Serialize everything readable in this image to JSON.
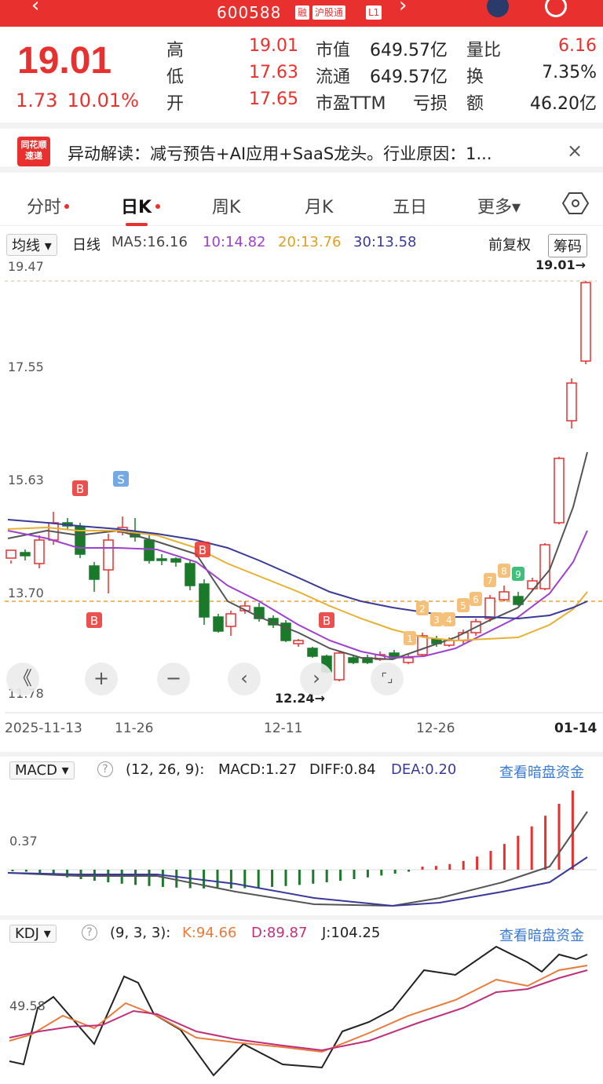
{
  "header": {
    "code": "600588",
    "badges": [
      "融",
      "沪股通",
      "L1"
    ]
  },
  "quote": {
    "price": "19.01",
    "change": "1.73",
    "change_pct": "10.01%",
    "rows": [
      [
        {
          "l": "高",
          "v": "19.01",
          "c": "r"
        },
        {
          "l": "市值",
          "v": "649.57亿",
          "c": "k"
        },
        {
          "l": "量比",
          "v": "6.16",
          "c": "r"
        }
      ],
      [
        {
          "l": "低",
          "v": "17.63",
          "c": "r"
        },
        {
          "l": "流通",
          "v": "649.57亿",
          "c": "k"
        },
        {
          "l": "换",
          "v": "7.35%",
          "c": "k"
        }
      ],
      [
        {
          "l": "开",
          "v": "17.65",
          "c": "r"
        },
        {
          "l": "市盈TTM",
          "v": "亏损",
          "c": "k"
        },
        {
          "l": "额",
          "v": "46.20亿",
          "c": "k"
        }
      ]
    ]
  },
  "news": {
    "logo_top": "同花顺",
    "logo_bottom": "速递",
    "text": "异动解读：减亏预告+AI应用+SaaS龙头。行业原因：1...",
    "close": "×"
  },
  "tabs": [
    "分时",
    "日K",
    "周K",
    "月K",
    "五日",
    "更多▾"
  ],
  "ma": {
    "type": "均线 ▾",
    "period": "日线",
    "ma5": "MA5:16.16",
    "ma10": "10:14.82",
    "ma20": "20:13.76",
    "ma30": "30:13.58",
    "adjust": "前复权",
    "chips": "筹码"
  },
  "chart": {
    "y_labels": [
      "19.47",
      "17.55",
      "15.63",
      "13.70",
      "11.78"
    ],
    "high_label": "19.01→",
    "low_label": "12.24→",
    "x_labels": [
      "2025-11-13",
      "11-26",
      "12-11",
      "12-26",
      "01-14"
    ],
    "signals": [
      "B",
      "S",
      "B",
      "B",
      "B"
    ],
    "counts": [
      "1",
      "2",
      "3",
      "4",
      "5",
      "6",
      "7",
      "8",
      "9"
    ],
    "controls": [
      "《",
      "+",
      "−",
      "‹",
      "›",
      "⌜⌟"
    ]
  },
  "macd": {
    "name": "MACD ▾",
    "help": "?",
    "params": "(12, 26, 9):",
    "macd": "MACD:1.27",
    "diff": "DIFF:0.84",
    "dea": "DEA:0.20",
    "link": "查看暗盘资金",
    "y_label": "0.37"
  },
  "kdj": {
    "name": "KDJ ▾",
    "help": "?",
    "params": "(9, 3, 3):",
    "k": "K:94.66",
    "d": "D:89.87",
    "j": "J:104.25",
    "link": "查看暗盘资金",
    "y_label": "49.58"
  },
  "colors": {
    "up": "#e8312f",
    "down": "#1a7a2a",
    "ma5": "#555555",
    "ma10": "#a040d0",
    "ma20": "#e8b030",
    "ma30": "#3a3a9a"
  }
}
